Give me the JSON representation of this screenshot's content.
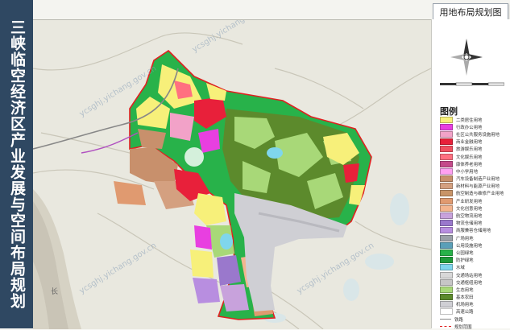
{
  "side_title": "三峡临空经济区产业发展与空间布局规划",
  "map_title": "用地布局规划图",
  "legend": {
    "header": "图例",
    "items": [
      {
        "label": "二类居住用地",
        "color": "#f7f07a",
        "kind": "fill"
      },
      {
        "label": "行政办公用地",
        "color": "#e83fe0",
        "kind": "fill"
      },
      {
        "label": "社区公共服务设施用地",
        "color": "#f2a2c8",
        "kind": "fill"
      },
      {
        "label": "商业金融用地",
        "color": "#e8203a",
        "kind": "fill"
      },
      {
        "label": "旅游娱乐用地",
        "color": "#f05060",
        "kind": "fill"
      },
      {
        "label": "文化娱乐用地",
        "color": "#ff7080",
        "kind": "fill"
      },
      {
        "label": "康体养老用地",
        "color": "#c44a8a",
        "kind": "fill"
      },
      {
        "label": "中小学用地",
        "color": "#ffa0f0",
        "kind": "fill"
      },
      {
        "label": "汽车设备制造产业用地",
        "color": "#c8906c",
        "kind": "fill"
      },
      {
        "label": "新材料与能源产业用地",
        "color": "#d4a080",
        "kind": "fill"
      },
      {
        "label": "航空制造与维修产业用地",
        "color": "#c89468",
        "kind": "fill"
      },
      {
        "label": "产业研发用地",
        "color": "#e09a70",
        "kind": "fill"
      },
      {
        "label": "文化创意用地",
        "color": "#f3b58f",
        "kind": "fill"
      },
      {
        "label": "航空物流用地",
        "color": "#c8a2dc",
        "kind": "fill"
      },
      {
        "label": "物流仓储用地",
        "color": "#9a78cc",
        "kind": "fill"
      },
      {
        "label": "商服兼容仓储用地",
        "color": "#b88ee0",
        "kind": "fill"
      },
      {
        "label": "广场用地",
        "color": "#9aa0a8",
        "kind": "fill"
      },
      {
        "label": "公用设施用地",
        "color": "#5a9fb8",
        "kind": "fill"
      },
      {
        "label": "公园绿地",
        "color": "#28b24a",
        "kind": "fill"
      },
      {
        "label": "防护绿地",
        "color": "#1f9a3a",
        "kind": "fill"
      },
      {
        "label": "水域",
        "color": "#7fd6ec",
        "kind": "fill"
      },
      {
        "label": "交通场站用地",
        "color": "#d8d8d8",
        "kind": "fill"
      },
      {
        "label": "交通枢纽用地",
        "color": "#c6c6c6",
        "kind": "fill"
      },
      {
        "label": "生态用地",
        "color": "#a8d878",
        "kind": "fill"
      },
      {
        "label": "基本农田",
        "color": "#5c8a2c",
        "kind": "fill"
      },
      {
        "label": "机场用地",
        "color": "#cfcfd4",
        "kind": "fill"
      },
      {
        "label": "高速公路",
        "color": "#ffffff",
        "kind": "fill"
      },
      {
        "label": "铁路",
        "color": "#888888",
        "kind": "line"
      },
      {
        "label": "规划范围",
        "color": "#e02020",
        "kind": "redline"
      }
    ]
  },
  "map_labels": {
    "river_label": "长",
    "watermark": "ycsghj.yichang.gov.cn"
  },
  "colors": {
    "banner": "#2f4862",
    "boundary": "#e02020",
    "green": "#28b24a",
    "farmland": "#5c8a2c",
    "airport": "#cfcfd4"
  }
}
